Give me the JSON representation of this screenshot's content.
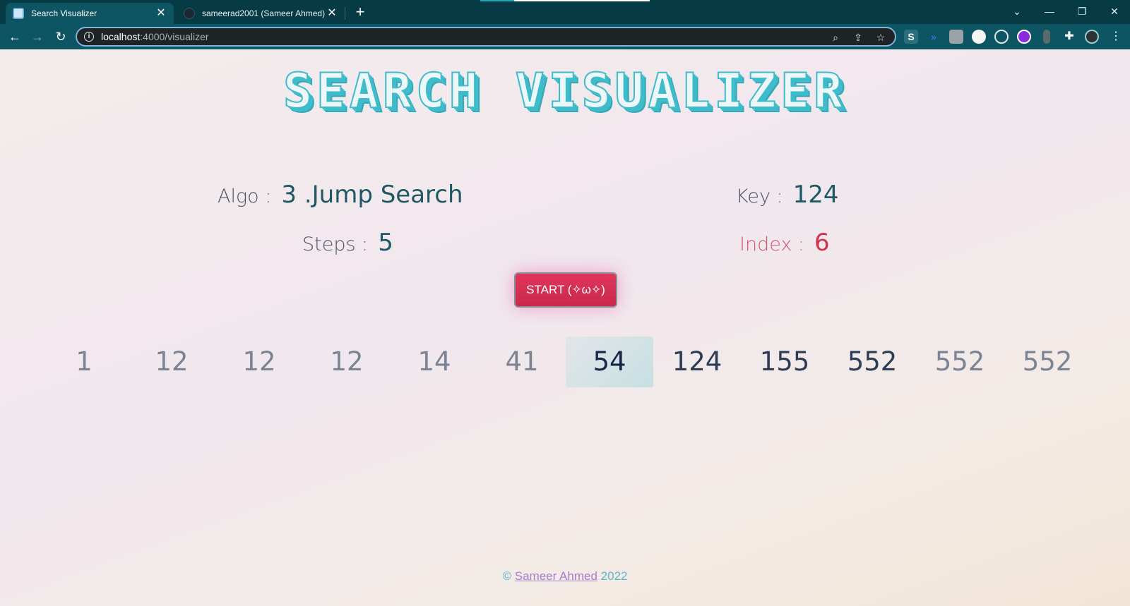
{
  "browser": {
    "tabs": [
      {
        "title": "Search Visualizer",
        "active": true
      },
      {
        "title": "sameerad2001 (Sameer Ahmed)",
        "active": false
      }
    ],
    "close_glyph": "✕",
    "new_tab_glyph": "+",
    "url_host": "localhost",
    "url_rest": ":4000/visualizer",
    "colors": {
      "frame": "#063b46",
      "toolbar": "#0d5563",
      "omnibox": "#1e2326"
    }
  },
  "app": {
    "title": "SEARCH VISUALIZER",
    "algo_label": "Algo :",
    "algo_value": "3 .Jump Search",
    "key_label": "Key :",
    "key_value": "124",
    "steps_label": "Steps :",
    "steps_value": "5",
    "index_label": "Index :",
    "index_value": "6",
    "start_button": "START (✧ω✧)",
    "array": [
      {
        "value": "1",
        "state": "visited"
      },
      {
        "value": "12",
        "state": "visited"
      },
      {
        "value": "12",
        "state": "visited"
      },
      {
        "value": "12",
        "state": "visited"
      },
      {
        "value": "14",
        "state": "visited"
      },
      {
        "value": "41",
        "state": "visited"
      },
      {
        "value": "54",
        "state": "current"
      },
      {
        "value": "124",
        "state": "ahead"
      },
      {
        "value": "155",
        "state": "ahead"
      },
      {
        "value": "552",
        "state": "ahead"
      },
      {
        "value": "552",
        "state": "visited"
      },
      {
        "value": "552",
        "state": "visited"
      }
    ],
    "colors": {
      "accent": "#3fbccb",
      "button": "#d6304f",
      "index": "#d1324d",
      "highlight": "#c6e0e3"
    }
  },
  "footer": {
    "copyright": "©",
    "author": "Sameer Ahmed",
    "year": "2022"
  }
}
